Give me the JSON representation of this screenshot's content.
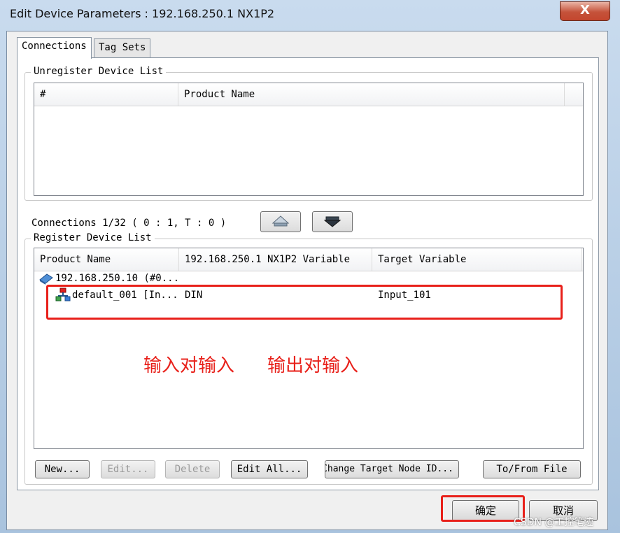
{
  "window": {
    "title": "Edit Device Parameters : 192.168.250.1 NX1P2",
    "close_glyph": "X"
  },
  "tabs": [
    {
      "label": "Connections",
      "active": true
    },
    {
      "label": "Tag Sets",
      "active": false
    }
  ],
  "unregister_list": {
    "group_label": "Unregister Device List",
    "columns": [
      "#",
      "Product Name"
    ]
  },
  "connections_status": "Connections 1/32 ( 0 : 1, T : 0 )",
  "toolbar_icons": [
    "register-down-icon",
    "unregister-up-icon"
  ],
  "register_list": {
    "group_label": "Register Device List",
    "columns": [
      "Product Name",
      "192.168.250.1 NX1P2 Variable",
      "Target Variable"
    ],
    "rows": [
      {
        "product": "192.168.250.10 (#0...",
        "variable": "",
        "target": "",
        "icon": "network-device-icon"
      },
      {
        "product": "default_001 [In...",
        "variable": "DIN",
        "target": "Input_101",
        "icon": "connection-node-icon"
      }
    ]
  },
  "annotation": {
    "text1": "输入对输入",
    "text2": "输出对输入",
    "color": "#e8201a"
  },
  "action_buttons": {
    "new": "New...",
    "edit": "Edit...",
    "delete": "Delete",
    "edit_all": "Edit All...",
    "change_target": "Change Target Node ID...",
    "to_from_file": "To/From File"
  },
  "dialog_buttons": {
    "ok": "确定",
    "cancel": "取消"
  },
  "watermark": "CSDN @工控笔迹"
}
